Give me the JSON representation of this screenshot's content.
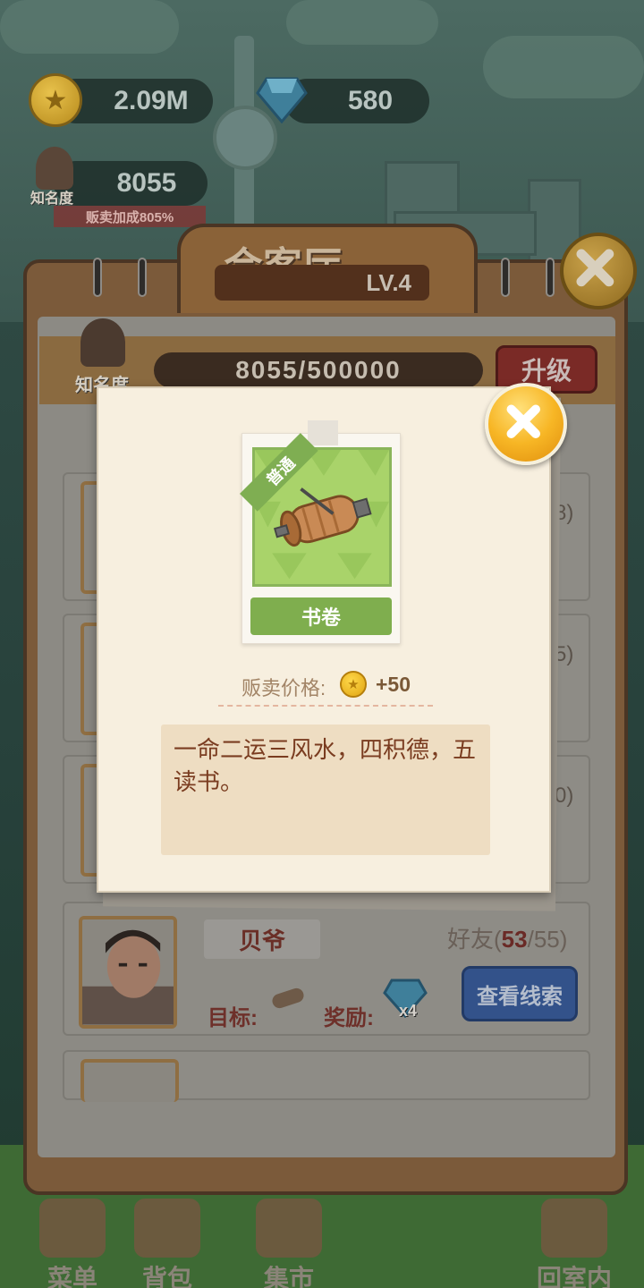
{
  "hud": {
    "coins": "2.09M",
    "diamonds": "580",
    "fame_value": "8055",
    "fame_label": "知名度",
    "sale_bonus": "贩卖加成805%"
  },
  "panel": {
    "title": "会客厅",
    "level": "LV.4",
    "fame_label": "知名度",
    "progress": "8055/500000",
    "upgrade_label": "升级",
    "row_counts": [
      "8)",
      "5)",
      "0)"
    ],
    "npc": {
      "name": "贝爷",
      "friend_label": "好友(",
      "friend_current": "53",
      "friend_sep": "/",
      "friend_max": "55)",
      "target_label": "目标:",
      "reward_label": "奖励:",
      "reward_count": "x4",
      "clue_button": "查看线索"
    }
  },
  "nav": {
    "items": [
      "菜单",
      "背包",
      "集市",
      "回室内"
    ]
  },
  "popup": {
    "rarity": "普通",
    "item_name": "书卷",
    "price_label": "贩卖价格:",
    "price_value": "+50",
    "description": "一命二运三风水，四积德，五读书。"
  },
  "colors": {
    "popup_bg": "#f7efdf",
    "item_green": "#7fae4e",
    "desc_text": "#7a3c20",
    "close_orange": "#f7b625"
  }
}
